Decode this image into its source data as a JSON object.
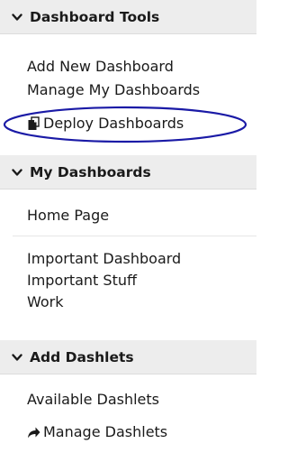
{
  "sections": [
    {
      "title": "Dashboard Tools",
      "items": [
        "Add New Dashboard",
        "Manage My Dashboards",
        "Deploy Dashboards"
      ]
    },
    {
      "title": "My Dashboards",
      "items": [
        "Home Page",
        "Important Dashboard",
        "Important Stuff",
        "Work"
      ]
    },
    {
      "title": "Add Dashlets",
      "items": [
        "Available Dashlets",
        "Manage Dashlets"
      ]
    }
  ],
  "icons": {
    "chevron": "chevron-down-icon",
    "deploy": "document-icon",
    "manage_dashlets": "share-arrow-icon"
  },
  "colors": {
    "header_bg": "#ededed",
    "highlight": "#1a1aa6"
  }
}
